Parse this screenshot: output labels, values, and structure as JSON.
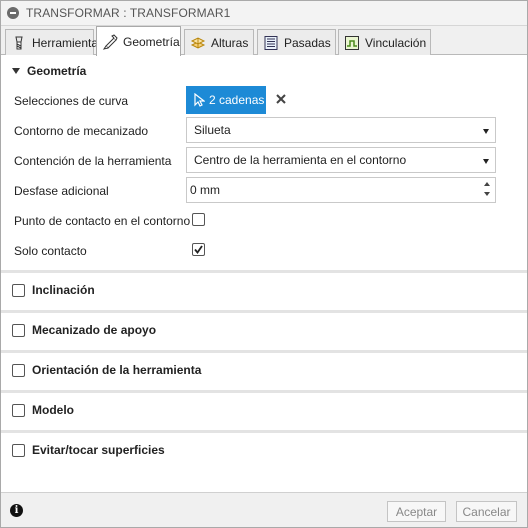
{
  "window": {
    "title": "TRANSFORMAR : TRANSFORMAR1"
  },
  "tabs": [
    {
      "label": "Herramienta",
      "icon": "tool-icon",
      "active": false
    },
    {
      "label": "Geometría",
      "icon": "geometry-icon",
      "active": true
    },
    {
      "label": "Alturas",
      "icon": "heights-icon",
      "active": false
    },
    {
      "label": "Pasadas",
      "icon": "passes-icon",
      "active": false
    },
    {
      "label": "Vinculación",
      "icon": "linking-icon",
      "active": false
    }
  ],
  "geometry": {
    "header": "Geometría",
    "curve_selection": {
      "label": "Selecciones de curva",
      "button": "2 cadenas"
    },
    "machining_boundary": {
      "label": "Contorno de mecanizado",
      "value": "Silueta"
    },
    "tool_containment": {
      "label": "Contención de la herramienta",
      "value": "Centro de la herramienta en el contorno"
    },
    "additional_offset": {
      "label": "Desfase adicional",
      "value": "0 mm"
    },
    "contact_point": {
      "label": "Punto de contacto en el contorno",
      "checked": false
    },
    "contact_only": {
      "label": "Solo contacto",
      "checked": true
    }
  },
  "sections": [
    {
      "label": "Inclinación",
      "checked": false
    },
    {
      "label": "Mecanizado de apoyo",
      "checked": false
    },
    {
      "label": "Orientación de la herramienta",
      "checked": false
    },
    {
      "label": "Modelo",
      "checked": false
    },
    {
      "label": "Evitar/tocar superficies",
      "checked": false
    }
  ],
  "footer": {
    "ok_label": "Aceptar",
    "cancel_label": "Cancelar"
  },
  "colors": {
    "accent": "#1d8ad6",
    "panel_bg": "#f0f0f0"
  }
}
